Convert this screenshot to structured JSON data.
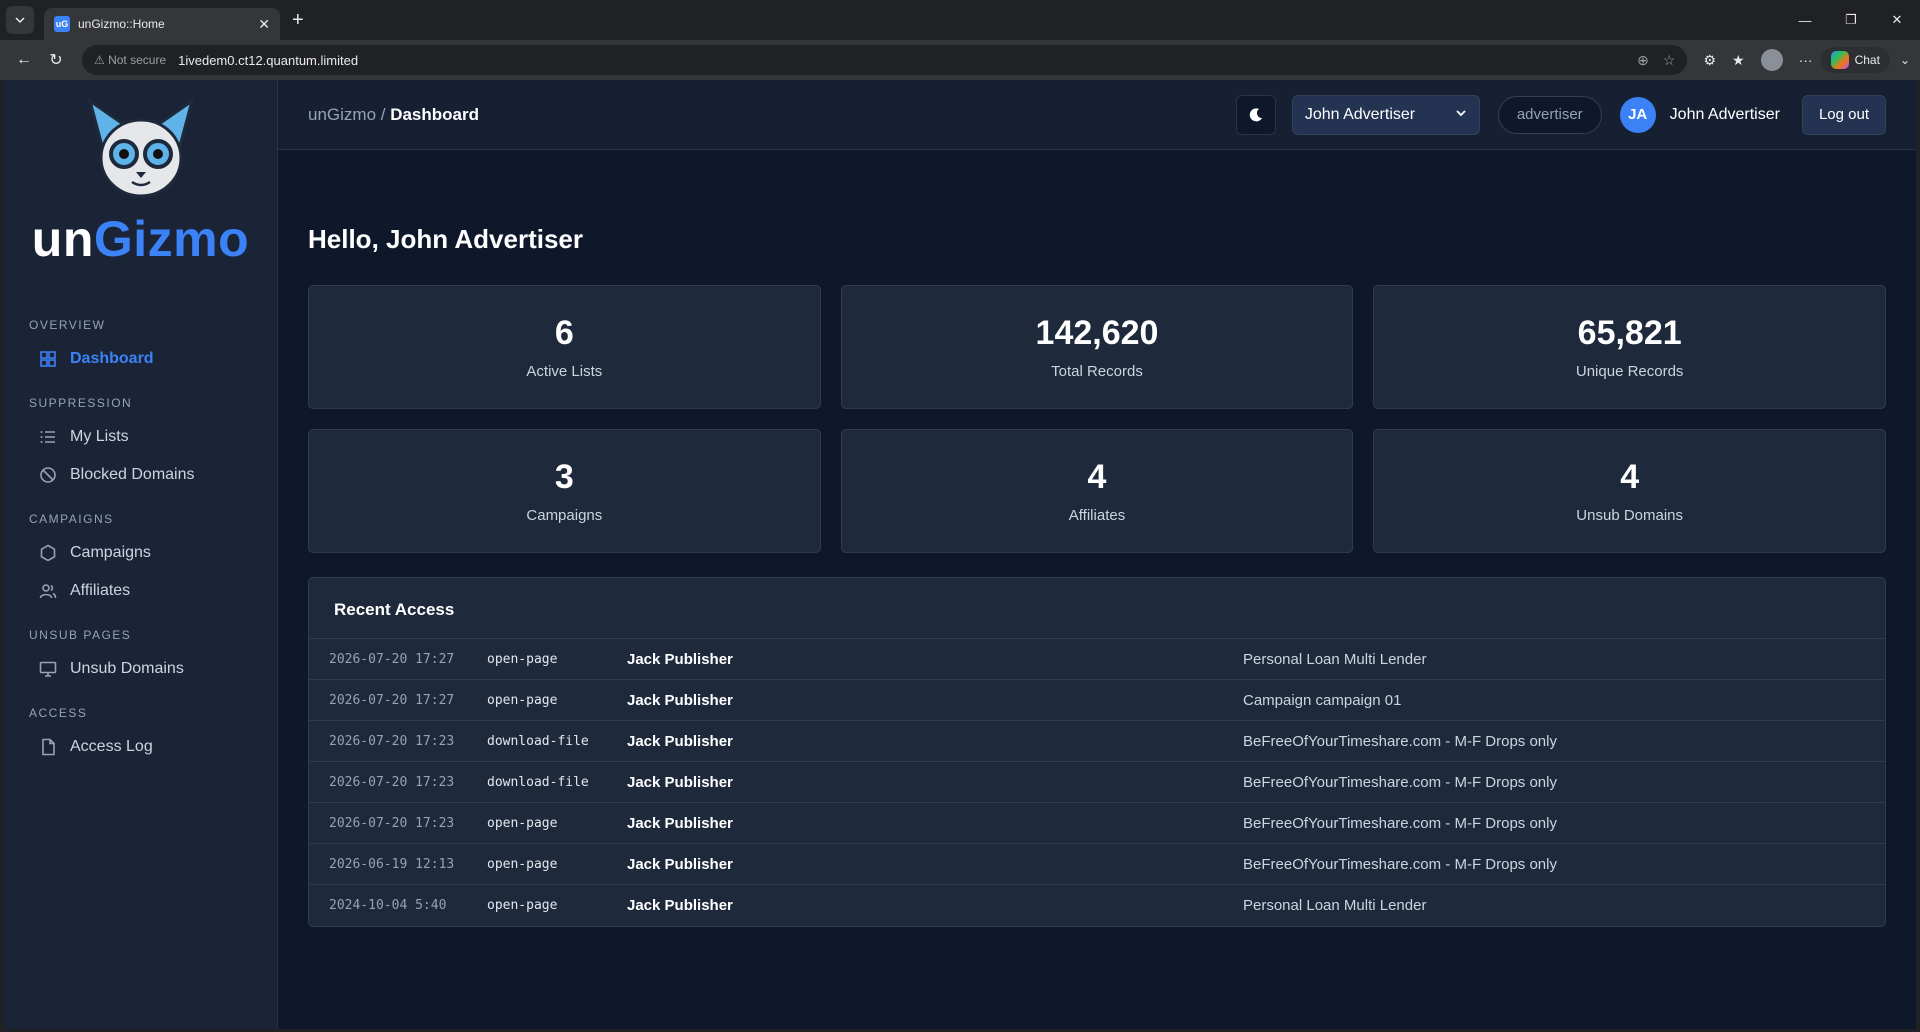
{
  "browser": {
    "tab_title": "unGizmo::Home",
    "tab_favicon": "uG",
    "not_secure": "Not secure",
    "url": "1ivedem0.ct12.quantum.limited",
    "chat_label": "Chat"
  },
  "sidebar": {
    "logo_prefix": "un",
    "logo_suffix": "Gizmo",
    "sections": [
      {
        "heading": "OVERVIEW",
        "items": [
          {
            "label": "Dashboard",
            "icon": "grid-icon",
            "active": true
          }
        ]
      },
      {
        "heading": "SUPPRESSION",
        "items": [
          {
            "label": "My Lists",
            "icon": "list-icon"
          },
          {
            "label": "Blocked Domains",
            "icon": "block-icon"
          }
        ]
      },
      {
        "heading": "CAMPAIGNS",
        "items": [
          {
            "label": "Campaigns",
            "icon": "hexagon-icon"
          },
          {
            "label": "Affiliates",
            "icon": "users-icon"
          }
        ]
      },
      {
        "heading": "UNSUB PAGES",
        "items": [
          {
            "label": "Unsub Domains",
            "icon": "monitor-icon"
          }
        ]
      },
      {
        "heading": "ACCESS",
        "items": [
          {
            "label": "Access Log",
            "icon": "file-icon"
          }
        ]
      }
    ]
  },
  "topbar": {
    "crumb_root": "unGizmo",
    "crumb_sep": " / ",
    "crumb_current": "Dashboard",
    "account_select": "John Advertiser",
    "role": "advertiser",
    "avatar_initials": "JA",
    "user_name": "John Advertiser",
    "logout": "Log out"
  },
  "main": {
    "greeting": "Hello, John Advertiser",
    "stats": [
      {
        "value": "6",
        "label": "Active Lists"
      },
      {
        "value": "142,620",
        "label": "Total Records"
      },
      {
        "value": "65,821",
        "label": "Unique Records"
      },
      {
        "value": "3",
        "label": "Campaigns"
      },
      {
        "value": "4",
        "label": "Affiliates"
      },
      {
        "value": "4",
        "label": "Unsub Domains"
      }
    ],
    "recent_title": "Recent Access",
    "recent": [
      {
        "time": "2026-07-20 17:27",
        "action": "open-page",
        "user": "Jack Publisher",
        "target": "Personal Loan Multi Lender"
      },
      {
        "time": "2026-07-20 17:27",
        "action": "open-page",
        "user": "Jack Publisher",
        "target": "Campaign campaign 01"
      },
      {
        "time": "2026-07-20 17:23",
        "action": "download-file",
        "user": "Jack Publisher",
        "target": "BeFreeOfYourTimeshare.com - M-F Drops only"
      },
      {
        "time": "2026-07-20 17:23",
        "action": "download-file",
        "user": "Jack Publisher",
        "target": "BeFreeOfYourTimeshare.com - M-F Drops only"
      },
      {
        "time": "2026-07-20 17:23",
        "action": "open-page",
        "user": "Jack Publisher",
        "target": "BeFreeOfYourTimeshare.com - M-F Drops only"
      },
      {
        "time": "2026-06-19 12:13",
        "action": "open-page",
        "user": "Jack Publisher",
        "target": "BeFreeOfYourTimeshare.com - M-F Drops only"
      },
      {
        "time": "2024-10-04 5:40",
        "action": "open-page",
        "user": "Jack Publisher",
        "target": "Personal Loan Multi Lender"
      }
    ]
  },
  "colors": {
    "accent": "#3b82f6",
    "bg": "#0f172a",
    "card": "#1e293b",
    "sidebar": "#1b2436"
  }
}
